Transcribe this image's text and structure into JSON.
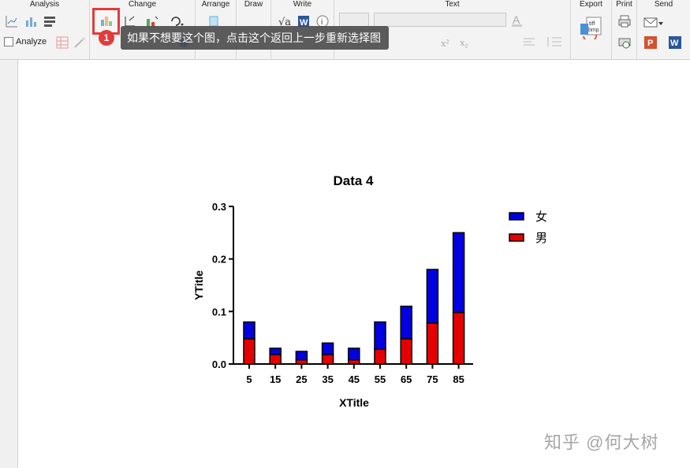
{
  "ribbon": {
    "groups": {
      "analysis": "Analysis",
      "change": "Change",
      "arrange": "Arrange",
      "draw": "Draw",
      "write": "Write",
      "text": "Text",
      "export": "Export",
      "print": "Print",
      "send": "Send"
    },
    "analyze_label": "Analyze"
  },
  "callout": {
    "badge": "1",
    "tooltip": "如果不想要这个图，点击这个返回上一步重新选择图"
  },
  "watermark": "知乎 @何大树",
  "chart_data": {
    "type": "bar",
    "stacked": true,
    "title": "Data 4",
    "xlabel": "XTitle",
    "ylabel": "YTitle",
    "ylim": [
      0,
      0.3
    ],
    "yticks": [
      "0.0",
      "0.1",
      "0.2",
      "0.3"
    ],
    "categories": [
      "5",
      "15",
      "25",
      "35",
      "45",
      "55",
      "65",
      "75",
      "85"
    ],
    "series": [
      {
        "name": "男",
        "color": "#e50000",
        "values": [
          0.048,
          0.018,
          0.008,
          0.018,
          0.008,
          0.028,
          0.048,
          0.078,
          0.098
        ]
      },
      {
        "name": "女",
        "color": "#0000e0",
        "values": [
          0.032,
          0.012,
          0.016,
          0.022,
          0.022,
          0.052,
          0.062,
          0.102,
          0.152
        ]
      }
    ],
    "legend": {
      "placement": "right",
      "entries": [
        "女",
        "男"
      ]
    }
  }
}
